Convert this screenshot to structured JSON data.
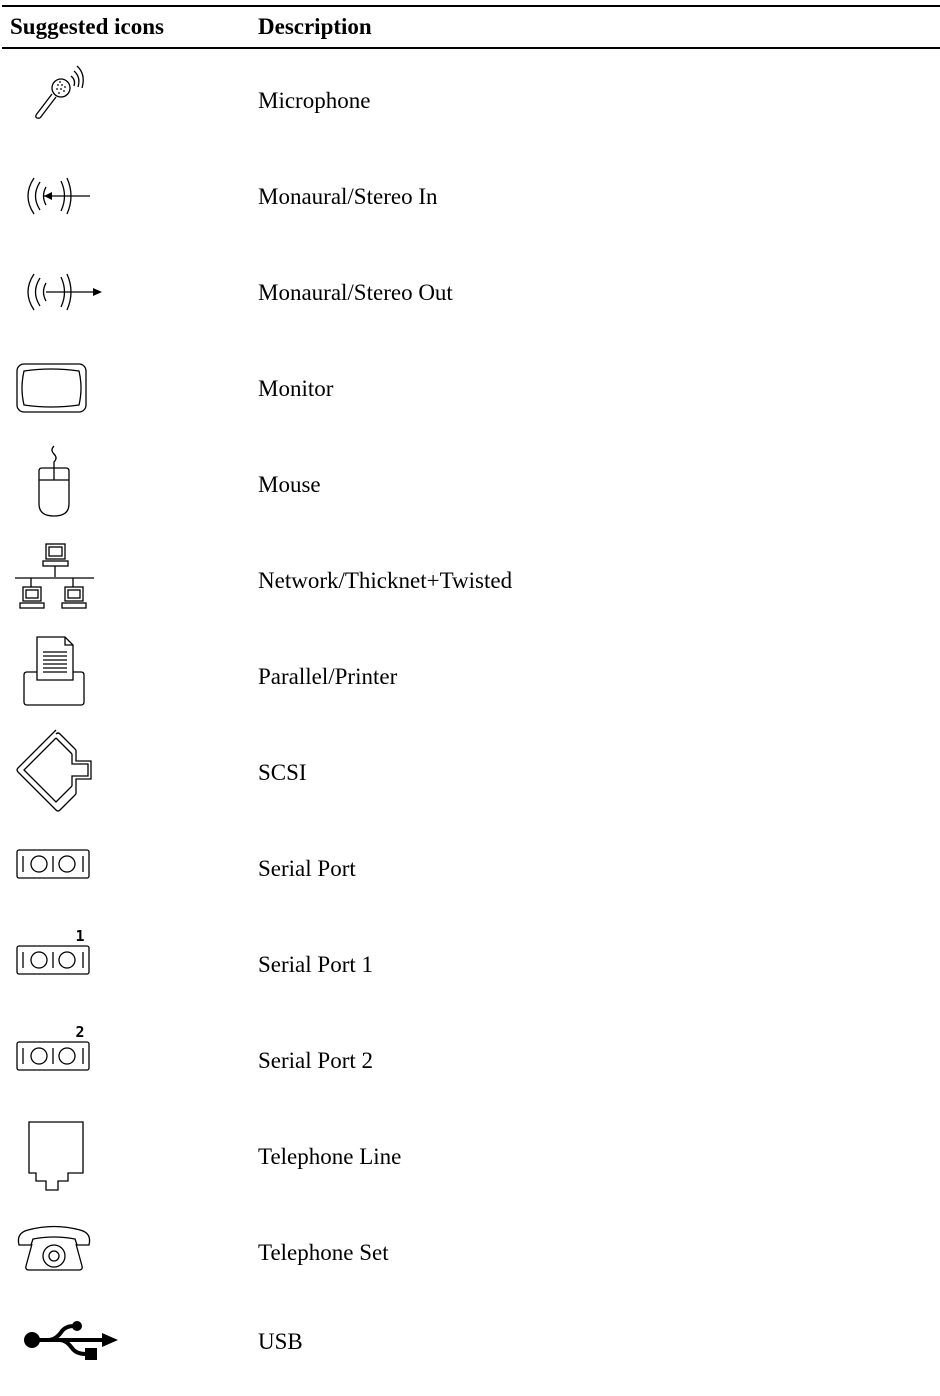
{
  "table": {
    "headers": {
      "icons": "Suggested icons",
      "description": "Description"
    },
    "rows": [
      {
        "icon": "microphone-icon",
        "description": "Microphone"
      },
      {
        "icon": "audio-in-icon",
        "description": "Monaural/Stereo In"
      },
      {
        "icon": "audio-out-icon",
        "description": "Monaural/Stereo Out"
      },
      {
        "icon": "monitor-icon",
        "description": "Monitor"
      },
      {
        "icon": "mouse-icon",
        "description": "Mouse"
      },
      {
        "icon": "network-icon",
        "description": "Network/Thicknet+Twisted"
      },
      {
        "icon": "printer-icon",
        "description": "Parallel/Printer"
      },
      {
        "icon": "scsi-icon",
        "description": "SCSI"
      },
      {
        "icon": "serial-port-icon",
        "description": "Serial Port"
      },
      {
        "icon": "serial-port-1-icon",
        "description": "Serial Port 1",
        "badge": "1"
      },
      {
        "icon": "serial-port-2-icon",
        "description": "Serial Port 2",
        "badge": "2"
      },
      {
        "icon": "telephone-line-icon",
        "description": "Telephone Line"
      },
      {
        "icon": "telephone-set-icon",
        "description": "Telephone Set"
      },
      {
        "icon": "usb-icon",
        "description": "USB"
      }
    ]
  }
}
